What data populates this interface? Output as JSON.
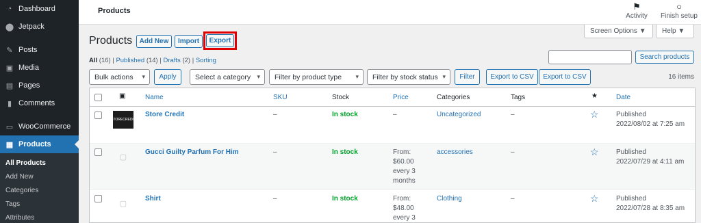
{
  "sidebar": {
    "top_items": [
      {
        "label": "Dashboard",
        "icon": "gauge-icon"
      },
      {
        "label": "Jetpack",
        "icon": "jetpack-icon"
      }
    ],
    "mid_items": [
      {
        "label": "Posts",
        "icon": "pin-icon"
      },
      {
        "label": "Media",
        "icon": "media-icon"
      },
      {
        "label": "Pages",
        "icon": "page-icon"
      },
      {
        "label": "Comments",
        "icon": "comment-icon"
      }
    ],
    "woo": {
      "label": "WooCommerce",
      "icon": "woo-icon"
    },
    "products": {
      "label": "Products",
      "icon": "archive-icon"
    },
    "submenu": [
      "All Products",
      "Add New",
      "Categories",
      "Tags",
      "Attributes"
    ]
  },
  "topbar": {
    "title": "Products",
    "activity_label": "Activity",
    "finish_label": "Finish setup"
  },
  "header": {
    "screen_options": "Screen Options ▼",
    "help": "Help ▼",
    "page_title": "Products",
    "add_new": "Add New",
    "import": "Import",
    "export": "Export"
  },
  "filters_status": {
    "all": "All",
    "all_count": "(16)",
    "published": "Published",
    "published_count": "(14)",
    "drafts": "Drafts",
    "drafts_count": "(2)",
    "sorting": "Sorting"
  },
  "search": {
    "button": "Search products",
    "value": ""
  },
  "toolbar": {
    "bulk_actions": "Bulk actions",
    "apply": "Apply",
    "category": "Select a category",
    "product_type": "Filter by product type",
    "stock_status": "Filter by stock status",
    "filter": "Filter",
    "export_csv_1": "Export to CSV",
    "export_csv_2": "Export to CSV",
    "items_count": "16 items"
  },
  "table": {
    "columns": {
      "name": "Name",
      "sku": "SKU",
      "stock": "Stock",
      "price": "Price",
      "categories": "Categories",
      "tags": "Tags",
      "date": "Date"
    },
    "rows": [
      {
        "name": "Store Credit",
        "thumb_text": "STORECREDIT",
        "sku": "–",
        "stock": "In stock",
        "price": [
          "–"
        ],
        "category": "Uncategorized",
        "tags": "–",
        "date_status": "Published",
        "date": "2022/08/02 at 7:25 am"
      },
      {
        "name": "Gucci Guilty Parfum For Him",
        "sku": "–",
        "stock": "In stock",
        "price": [
          "From:",
          "$60.00",
          "every 3",
          "months"
        ],
        "category": "accessories",
        "tags": "–",
        "date_status": "Published",
        "date": "2022/07/29 at 4:11 am"
      },
      {
        "name": "Shirt",
        "sku": "–",
        "stock": "In stock",
        "price": [
          "From:",
          "$48.00",
          "every 3"
        ],
        "category": "Clothing",
        "tags": "–",
        "date_status": "Published",
        "date": "2022/07/28 at 8:35 am"
      }
    ]
  }
}
